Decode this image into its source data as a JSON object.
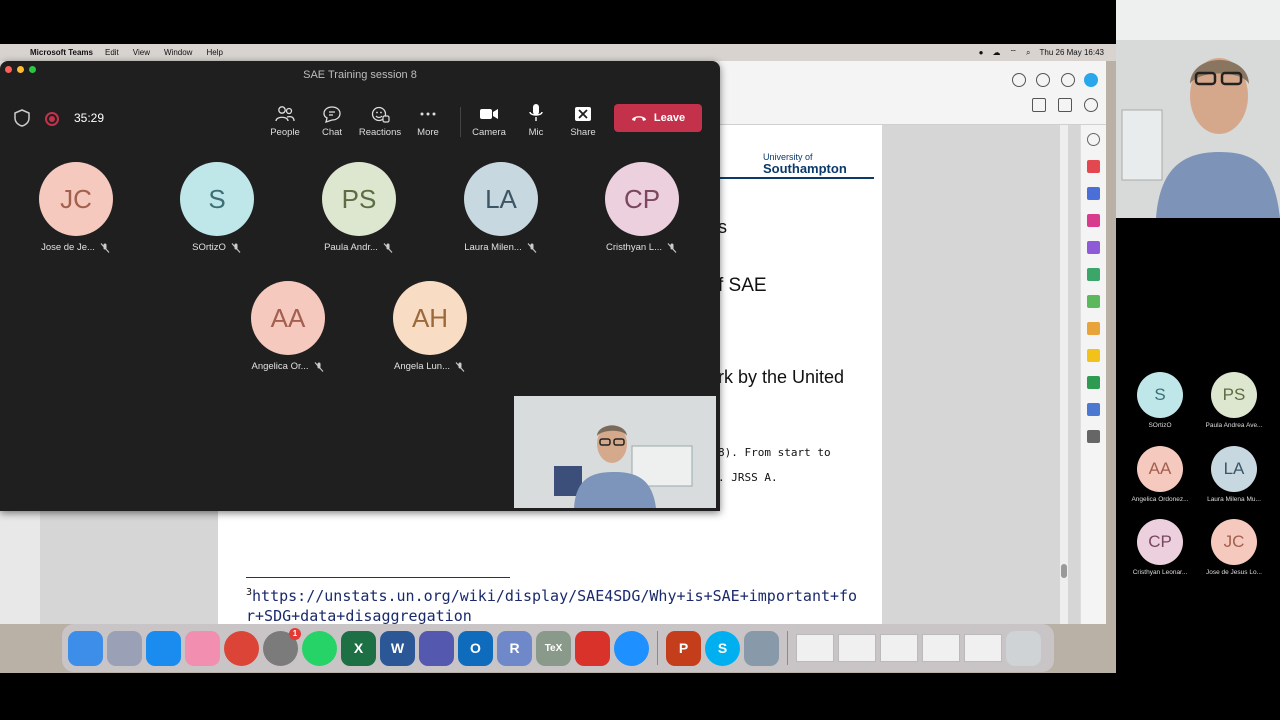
{
  "menubar": {
    "app": "Microsoft Teams",
    "items": [
      "Edit",
      "View",
      "Window",
      "Help"
    ],
    "datetime": "Thu 26 May  16:43"
  },
  "pdf": {
    "logo_top": "University of",
    "logo_name": "Southampton",
    "fragments": [
      "s",
      "f SAE",
      "rk by the United",
      "8). From start to",
      ". JRSS A."
    ],
    "footnote_mark": "3",
    "footnote_url": "https://unstats.un.org/wiki/display/SAE4SDG/Why+is+SAE+important+for+SDG+data+disaggregation"
  },
  "teams": {
    "title": "SAE Training session 8",
    "timer": "35:29",
    "controls": {
      "people": "People",
      "chat": "Chat",
      "reactions": "Reactions",
      "more": "More",
      "camera": "Camera",
      "mic": "Mic",
      "share": "Share"
    },
    "leave_label": "Leave",
    "participants": [
      {
        "initials": "JC",
        "name": "Jose de Je...",
        "bg": "#f5c9bd",
        "fg": "#a35f4f"
      },
      {
        "initials": "S",
        "name": "SOrtizO",
        "bg": "#bfe7ea",
        "fg": "#3b6f74"
      },
      {
        "initials": "PS",
        "name": "Paula Andr...",
        "bg": "#dde6cf",
        "fg": "#5c6d44"
      },
      {
        "initials": "LA",
        "name": "Laura Milen...",
        "bg": "#c8d8e0",
        "fg": "#3d5666"
      },
      {
        "initials": "CP",
        "name": "Cristhyan L...",
        "bg": "#ecd0de",
        "fg": "#7a4660"
      },
      {
        "initials": "AA",
        "name": "Angelica Or...",
        "bg": "#f5c9bd",
        "fg": "#a35f4f"
      },
      {
        "initials": "AH",
        "name": "Angela Lun...",
        "bg": "#f9dcc4",
        "fg": "#9a6a3c"
      }
    ]
  },
  "side_panel": {
    "participants": [
      {
        "initials": "S",
        "name": "SOrtizO",
        "bg": "#bfe7ea",
        "fg": "#3b6f74"
      },
      {
        "initials": "PS",
        "name": "Paula Andrea Ave...",
        "bg": "#dde6cf",
        "fg": "#5c6d44"
      },
      {
        "initials": "AA",
        "name": "Angelica Ordonez...",
        "bg": "#f5c9bd",
        "fg": "#a35f4f"
      },
      {
        "initials": "LA",
        "name": "Laura Milena Mu...",
        "bg": "#c8d8e0",
        "fg": "#3d5666"
      },
      {
        "initials": "CP",
        "name": "Cristhyan Leonar...",
        "bg": "#ecd0de",
        "fg": "#7a4660"
      },
      {
        "initials": "JC",
        "name": "Jose de Jesus Lo...",
        "bg": "#f5c9bd",
        "fg": "#a35f4f"
      }
    ]
  },
  "dock": {
    "r_label": "R",
    "tex_label": "TeX",
    "p_label": "P",
    "s_label": "S",
    "x_label": "X",
    "w_label": "W",
    "o_label": "O",
    "badge": "1"
  }
}
